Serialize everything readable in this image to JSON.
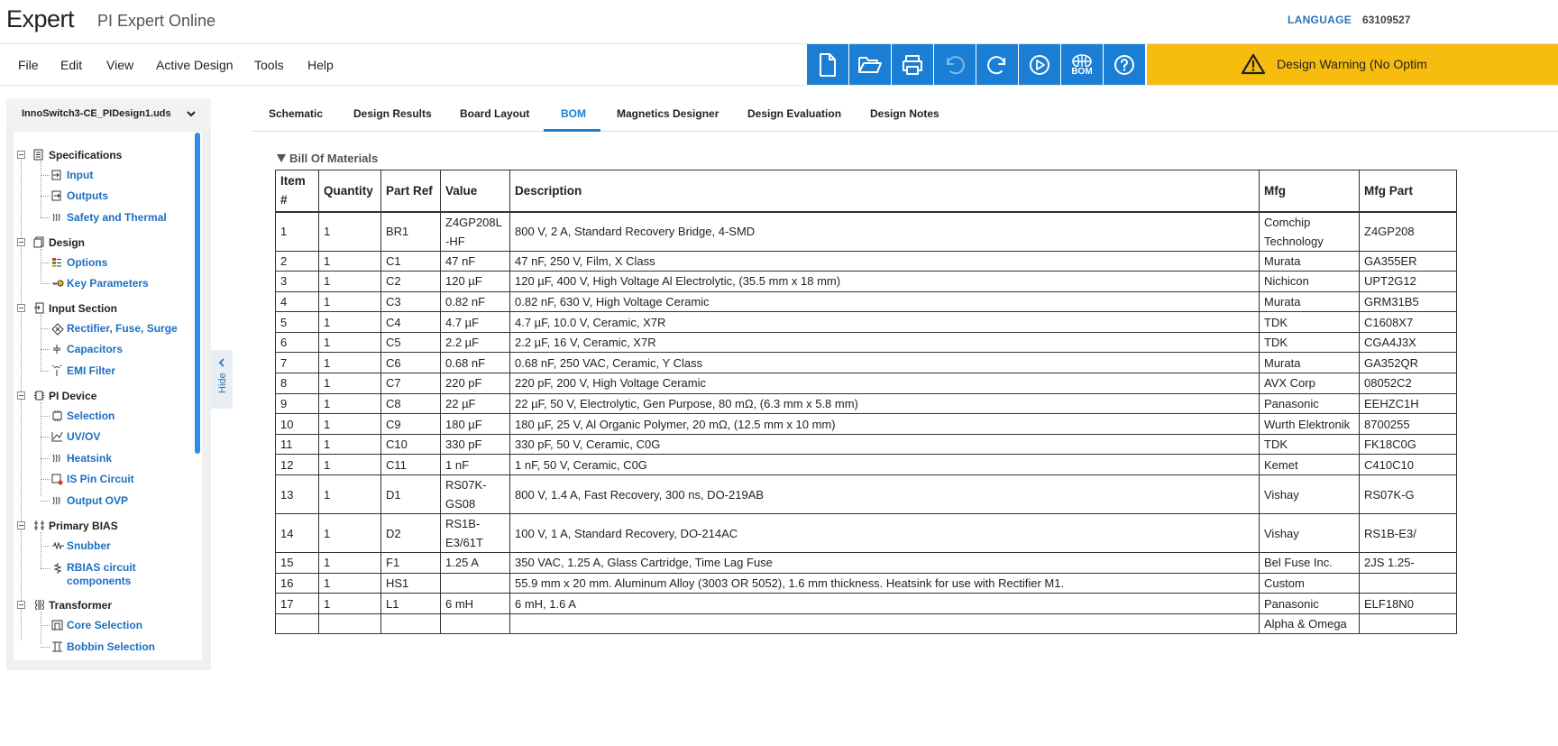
{
  "header": {
    "logo_text": "Expert",
    "app_title": "PI Expert Online",
    "language": "LANGUAGE",
    "account": "63109527"
  },
  "menu": [
    "File",
    "Edit",
    "View",
    "Active Design",
    "Tools",
    "Help"
  ],
  "toolbar": {
    "buttons": [
      "new-document-icon",
      "open-folder-icon",
      "print-icon",
      "undo-icon",
      "redo-icon",
      "run-icon",
      "bom-icon",
      "help-icon"
    ],
    "bom_label": "BOM",
    "accent": "#1a7fd4"
  },
  "warning": {
    "text": "Design Warning (No Optim",
    "color": "#f6bd0f"
  },
  "sidebar": {
    "file_name": "InnoSwitch3-CE_PIDesign1.uds",
    "hide_label": "Hide",
    "sections": [
      {
        "label": "Specifications",
        "children": [
          "Input",
          "Outputs",
          "Safety and Thermal"
        ]
      },
      {
        "label": "Design",
        "children": [
          "Options",
          "Key Parameters"
        ]
      },
      {
        "label": "Input Section",
        "children": [
          "Rectifier, Fuse, Surge",
          "Capacitors",
          "EMI Filter"
        ]
      },
      {
        "label": "PI Device",
        "children": [
          "Selection",
          "UV/OV",
          "Heatsink",
          "IS Pin Circuit",
          "Output OVP"
        ]
      },
      {
        "label": "Primary BIAS",
        "children": [
          "Snubber",
          "RBIAS circuit components"
        ]
      },
      {
        "label": "Transformer",
        "children": [
          "Core Selection",
          "Bobbin Selection"
        ]
      }
    ]
  },
  "tabs": [
    "Schematic",
    "Design Results",
    "Board Layout",
    "BOM",
    "Magnetics Designer",
    "Design Evaluation",
    "Design Notes"
  ],
  "active_tab": "BOM",
  "bom": {
    "title": "Bill Of Materials",
    "columns": [
      "Item #",
      "Quantity",
      "Part Ref",
      "Value",
      "Description",
      "Mfg",
      "Mfg Part"
    ],
    "rows": [
      [
        "1",
        "1",
        "BR1",
        "Z4GP208L-HF",
        "800 V, 2 A, Standard Recovery Bridge, 4-SMD",
        "Comchip Technology",
        "Z4GP208"
      ],
      [
        "2",
        "1",
        "C1",
        "47 nF",
        "47 nF, 250 V, Film, X Class",
        "Murata",
        "GA355ER"
      ],
      [
        "3",
        "1",
        "C2",
        "120 µF",
        "120 µF, 400 V, High Voltage Al Electrolytic, (35.5 mm x 18 mm)",
        "Nichicon",
        "UPT2G12"
      ],
      [
        "4",
        "1",
        "C3",
        "0.82 nF",
        "0.82 nF, 630 V, High Voltage Ceramic",
        "Murata",
        "GRM31B5"
      ],
      [
        "5",
        "1",
        "C4",
        "4.7 µF",
        "4.7 µF, 10.0 V, Ceramic, X7R",
        "TDK",
        "C1608X7"
      ],
      [
        "6",
        "1",
        "C5",
        "2.2 µF",
        "2.2 µF, 16 V, Ceramic, X7R",
        "TDK",
        "CGA4J3X"
      ],
      [
        "7",
        "1",
        "C6",
        "0.68 nF",
        "0.68 nF, 250 VAC, Ceramic, Y Class",
        "Murata",
        "GA352QR"
      ],
      [
        "8",
        "1",
        "C7",
        "220 pF",
        "220 pF, 200 V, High Voltage Ceramic",
        "AVX Corp",
        "08052C2"
      ],
      [
        "9",
        "1",
        "C8",
        "22 µF",
        "22 µF, 50 V, Electrolytic, Gen Purpose, 80 mΩ, (6.3 mm x 5.8 mm)",
        "Panasonic",
        "EEHZC1H"
      ],
      [
        "10",
        "1",
        "C9",
        "180 µF",
        "180 µF, 25 V, Al Organic Polymer, 20 mΩ, (12.5 mm x 10 mm)",
        "Wurth Elektronik",
        "8700255"
      ],
      [
        "11",
        "1",
        "C10",
        "330 pF",
        "330 pF, 50 V, Ceramic, C0G",
        "TDK",
        "FK18C0G"
      ],
      [
        "12",
        "1",
        "C11",
        "1 nF",
        "1 nF, 50 V, Ceramic, C0G",
        "Kemet",
        "C410C10"
      ],
      [
        "13",
        "1",
        "D1",
        "RS07K-GS08",
        "800 V, 1.4 A, Fast Recovery, 300 ns, DO-219AB",
        "Vishay",
        "RS07K-G"
      ],
      [
        "14",
        "1",
        "D2",
        "RS1B-E3/61T",
        "100 V, 1 A, Standard Recovery, DO-214AC",
        "Vishay",
        "RS1B-E3/"
      ],
      [
        "15",
        "1",
        "F1",
        "1.25 A",
        "350 VAC, 1.25 A, Glass Cartridge, Time Lag Fuse",
        "Bel Fuse Inc.",
        "2JS 1.25-"
      ],
      [
        "16",
        "1",
        "HS1",
        "",
        "55.9 mm x 20 mm. Aluminum Alloy (3003 OR 5052), 1.6 mm thickness. Heatsink for use with Rectifier M1.",
        "Custom",
        ""
      ],
      [
        "17",
        "1",
        "L1",
        "6 mH",
        "6 mH, 1.6 A",
        "Panasonic",
        "ELF18N0"
      ],
      [
        "",
        "",
        "",
        "",
        "",
        "Alpha & Omega",
        ""
      ]
    ]
  }
}
